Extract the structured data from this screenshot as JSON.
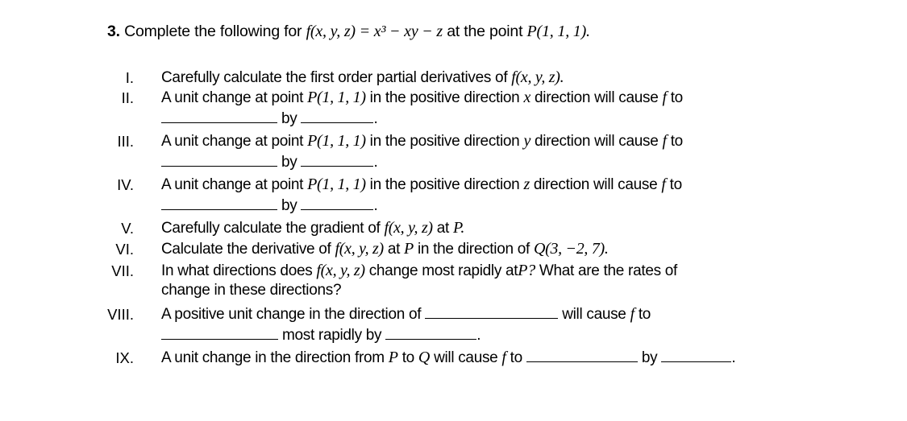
{
  "question": {
    "number": "3.",
    "intro": "Complete the following for",
    "function": "f(x, y, z) = x³ − xy − z",
    "point_text": "at the point",
    "point": "P(1, 1, 1)."
  },
  "items": [
    {
      "roman": "I.",
      "text": "Carefully calculate the first order partial derivatives of",
      "math": "f(x, y, z)."
    },
    {
      "roman": "II.",
      "pre": "A unit change at point",
      "point": "P(1, 1, 1)",
      "mid": "in the positive direction",
      "var": "x",
      "post": "direction will cause",
      "f": "f",
      "to": "to",
      "by": "by",
      "period": "."
    },
    {
      "roman": "III.",
      "pre": "A unit change at point",
      "point": "P(1, 1, 1)",
      "mid": "in the positive direction",
      "var": "y",
      "post": "direction will cause",
      "f": "f",
      "to": "to",
      "by": "by",
      "period": "."
    },
    {
      "roman": "IV.",
      "pre": "A unit change at point",
      "point": "P(1, 1, 1)",
      "mid": "in the positive direction",
      "var": "z",
      "post": "direction will cause",
      "f": "f",
      "to": "to",
      "by": "by",
      "period": "."
    },
    {
      "roman": "V.",
      "text": "Carefully calculate the gradient of",
      "math": "f(x, y, z)",
      "at": "at",
      "p": "P."
    },
    {
      "roman": "VI.",
      "text": "Calculate the derivative of",
      "math": "f(x, y, z)",
      "at": "at",
      "p": "P",
      "mid": "in the direction of",
      "q": "Q(3, −2, 7)."
    },
    {
      "roman": "VII.",
      "text": "In what directions does",
      "math": "f(x, y, z)",
      "mid": "change most rapidly at",
      "p": "P?",
      "post": "What are the rates of",
      "line2": "change in these directions?"
    },
    {
      "roman": "VIII.",
      "text": "A positive unit change in the direction of",
      "post": "will cause",
      "f": "f",
      "to": "to",
      "mid2": "most rapidly by",
      "period": "."
    },
    {
      "roman": "IX.",
      "text": "A unit change in the direction from",
      "p": "P",
      "to1": "to",
      "q": "Q",
      "post": "will cause",
      "f": "f",
      "to": "to",
      "by": "by",
      "period": "."
    }
  ]
}
